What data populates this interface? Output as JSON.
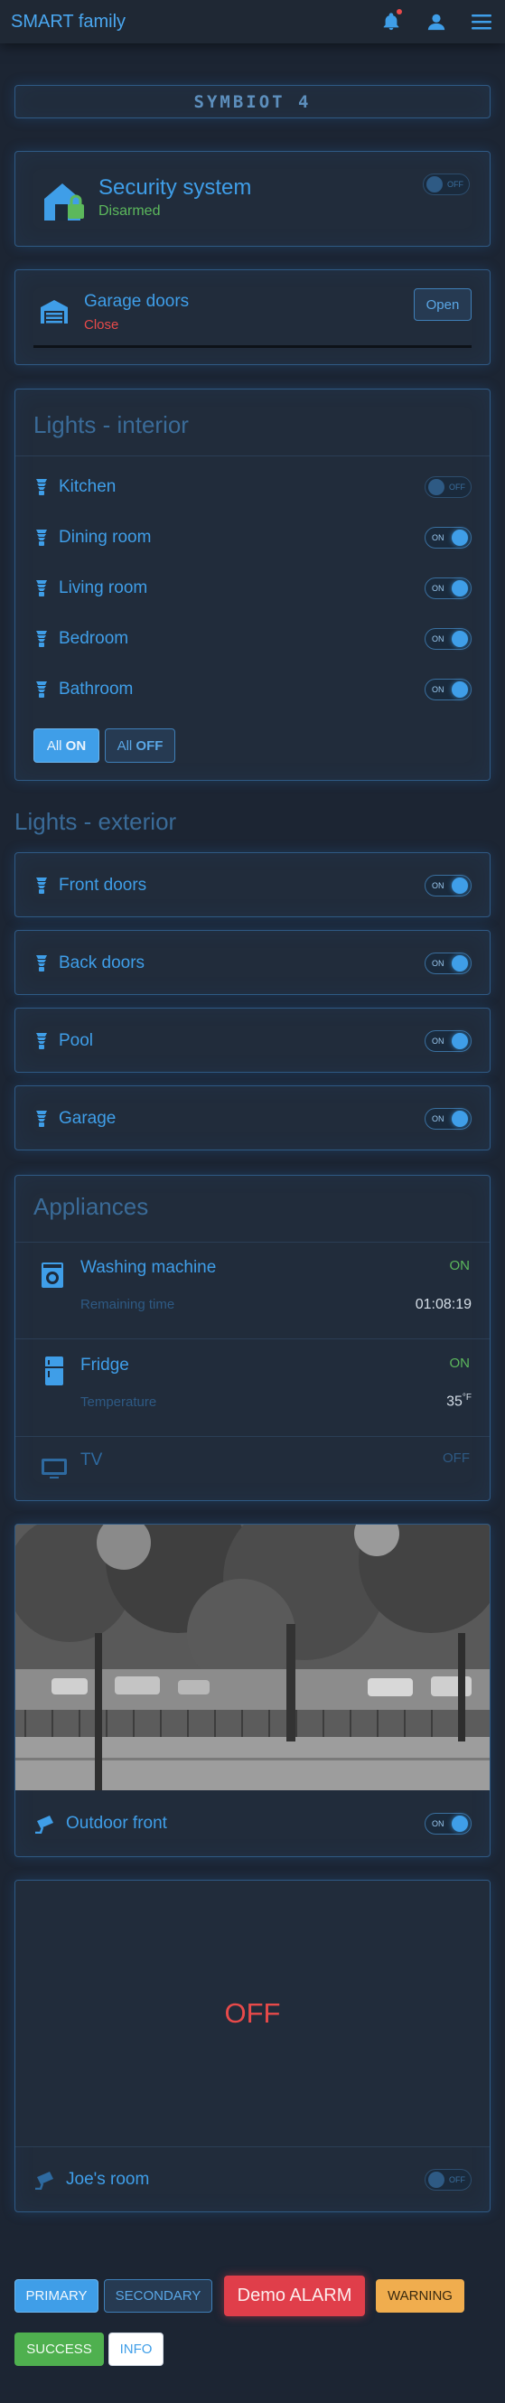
{
  "topbar": {
    "title": "SMART family",
    "icons": [
      "bell-icon",
      "user-icon",
      "menu-icon"
    ]
  },
  "brand": {
    "logo_text": "SYMBIOT 4"
  },
  "security": {
    "title": "Security system",
    "status": "Disarmed",
    "toggle": "OFF"
  },
  "garage_doors": {
    "title": "Garage doors",
    "status": "Close",
    "button": "Open"
  },
  "lights_interior": {
    "title": "Lights - interior",
    "items": [
      {
        "label": "Kitchen",
        "toggle": "OFF"
      },
      {
        "label": "Dining room",
        "toggle": "ON"
      },
      {
        "label": "Living room",
        "toggle": "ON"
      },
      {
        "label": "Bedroom",
        "toggle": "ON"
      },
      {
        "label": "Bathroom",
        "toggle": "ON"
      }
    ],
    "all_on": {
      "prefix": "All",
      "bold": "ON"
    },
    "all_off": {
      "prefix": "All",
      "bold": "OFF"
    }
  },
  "lights_exterior": {
    "title": "Lights - exterior",
    "items": [
      {
        "label": "Front doors",
        "toggle": "ON"
      },
      {
        "label": "Back doors",
        "toggle": "ON"
      },
      {
        "label": "Pool",
        "toggle": "ON"
      },
      {
        "label": "Garage",
        "toggle": "ON"
      }
    ]
  },
  "appliances": {
    "title": "Appliances",
    "washing": {
      "label": "Washing machine",
      "status": "ON",
      "sub_label": "Remaining time",
      "sub_value": "01:08:19"
    },
    "fridge": {
      "label": "Fridge",
      "status": "ON",
      "sub_label": "Temperature",
      "sub_value": "35",
      "unit": "°F"
    },
    "tv": {
      "label": "TV",
      "status": "OFF"
    }
  },
  "camera_front": {
    "label": "Outdoor front",
    "toggle": "ON"
  },
  "camera_joe": {
    "label": "Joe's room",
    "toggle": "OFF",
    "screen_text": "OFF"
  },
  "buttons": {
    "primary": "PRIMARY",
    "secondary": "SECONDARY",
    "alarm": "Demo ALARM",
    "warning": "WARNING",
    "success": "SUCCESS",
    "info": "INFO"
  },
  "colors": {
    "accent": "#3f9ee8",
    "background": "#1c2533",
    "green": "#5cb85c",
    "red": "#e84a4a",
    "warning": "#f0ad4e"
  }
}
